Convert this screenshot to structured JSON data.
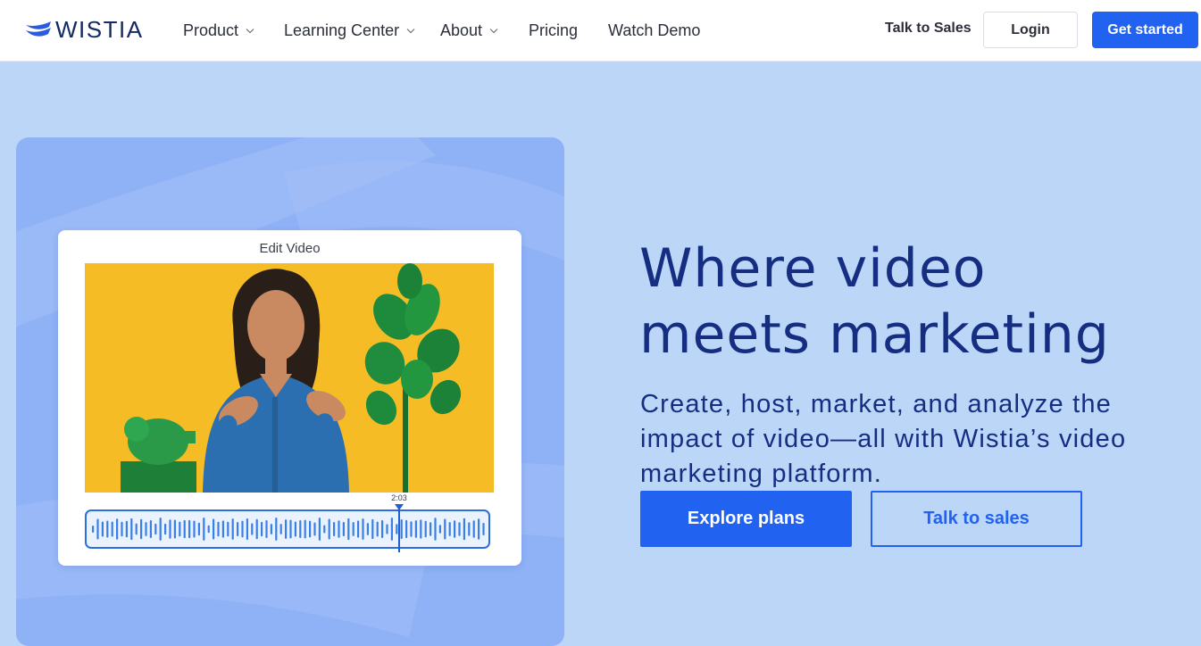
{
  "header": {
    "logo_text": "WISTIA",
    "logo_icon": "wistia-logo-mark",
    "nav": [
      {
        "label": "Product",
        "icon": "chevron-down-icon"
      },
      {
        "label": "Learning Center",
        "icon": "chevron-down-icon"
      },
      {
        "label": "About",
        "icon": "chevron-down-icon"
      },
      {
        "label": "Pricing"
      },
      {
        "label": "Watch Demo"
      }
    ],
    "talk_to_sales": "Talk to Sales",
    "login": "Login",
    "get_started": "Get started"
  },
  "media": {
    "editor_title": "Edit Video",
    "timecode": "2:03",
    "video_subject": "presenter-with-plant-video-thumbnail"
  },
  "hero": {
    "title_line1": "Where video",
    "title_line2": "meets marketing",
    "subtitle": "Create, host, market, and analyze the impact of video—all with Wistia’s video marketing platform.",
    "primary_cta": "Explore plans",
    "secondary_cta": "Talk to sales"
  },
  "colors": {
    "accent": "#2162f0",
    "navy": "#152e82",
    "page_background": "#bcd6f8",
    "panel_background": "#8fb1f6",
    "video_background": "#f6b61c",
    "plant_green": "#1d8a3c"
  }
}
